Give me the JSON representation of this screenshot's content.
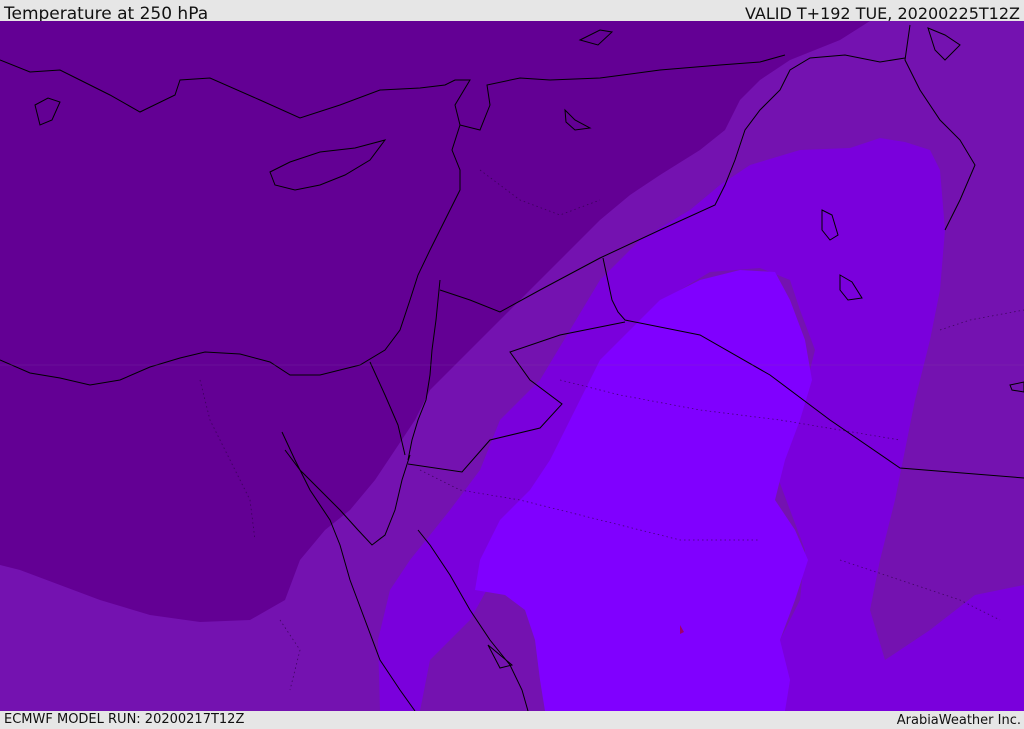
{
  "header": {
    "title": "Temperature at 250 hPa",
    "valid": "VALID T+192 TUE, 20200225T12Z"
  },
  "footer": {
    "model_run": "ECMWF MODEL RUN: 20200217T12Z",
    "brand": "ArabiaWeather Inc."
  },
  "map": {
    "field": "temperature",
    "level": "250 hPa",
    "shading_colors": [
      "#630094",
      "#7412b0",
      "#7a00dc",
      "#8000ff"
    ],
    "coastline_color": "#000000",
    "border_style": "solid",
    "internal_border_style": "dotted"
  }
}
